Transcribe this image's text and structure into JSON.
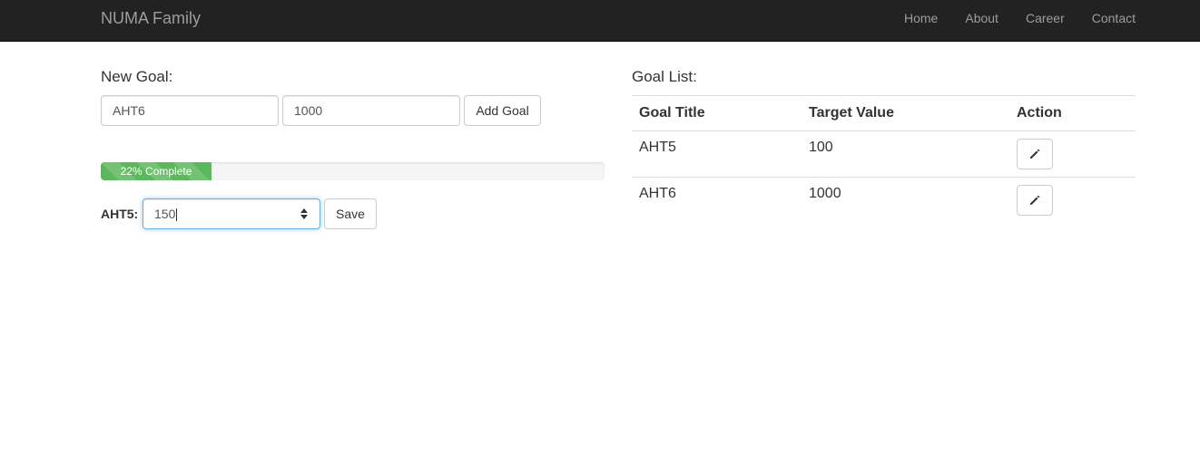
{
  "navbar": {
    "brand": "NUMA Family",
    "links": [
      "Home",
      "About",
      "Career",
      "Contact"
    ]
  },
  "new_goal": {
    "heading": "New Goal:",
    "title_value": "AHT6",
    "target_value": "1000",
    "add_button": "Add Goal"
  },
  "progress": {
    "percent": 22,
    "label": "22% Complete",
    "color": "#5cb85c"
  },
  "update": {
    "label": "AHT5:",
    "value": "150",
    "save_button": "Save"
  },
  "goal_list": {
    "heading": "Goal List:",
    "columns": [
      "Goal Title",
      "Target Value",
      "Action"
    ],
    "rows": [
      {
        "title": "AHT5",
        "target": "100",
        "action_icon": "pencil-icon"
      },
      {
        "title": "AHT6",
        "target": "1000",
        "action_icon": "pencil-icon"
      }
    ]
  }
}
